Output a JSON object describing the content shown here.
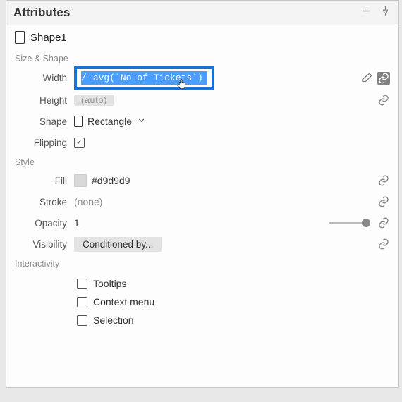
{
  "header": {
    "title": "Attributes"
  },
  "object": {
    "name": "Shape1"
  },
  "sections": {
    "size_shape": "Size & Shape",
    "style": "Style",
    "interactivity": "Interactivity"
  },
  "props": {
    "width": {
      "label": "Width",
      "prefix": "/ ",
      "formula": "avg(`No of Tickets`)"
    },
    "height": {
      "label": "Height",
      "value": "(auto)"
    },
    "shape": {
      "label": "Shape",
      "value": "Rectangle"
    },
    "flipping": {
      "label": "Flipping",
      "checked": true
    },
    "fill": {
      "label": "Fill",
      "hex": "#d9d9d9"
    },
    "stroke": {
      "label": "Stroke",
      "value": "(none)"
    },
    "opacity": {
      "label": "Opacity",
      "value": "1"
    },
    "visibility": {
      "label": "Visibility",
      "button": "Conditioned by..."
    }
  },
  "interactivity_items": [
    {
      "label": "Tooltips",
      "checked": false
    },
    {
      "label": "Context menu",
      "checked": false
    },
    {
      "label": "Selection",
      "checked": false
    }
  ]
}
